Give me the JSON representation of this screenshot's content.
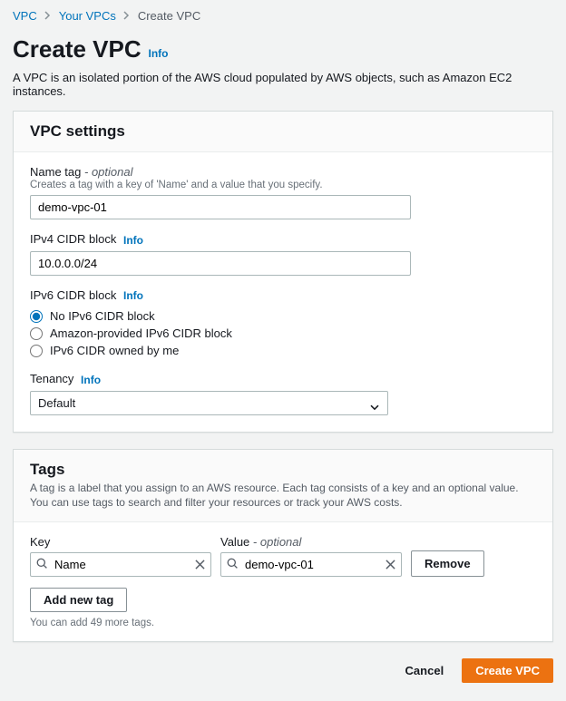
{
  "breadcrumb": {
    "items": [
      "VPC",
      "Your VPCs",
      "Create VPC"
    ]
  },
  "header": {
    "title": "Create VPC",
    "info": "Info",
    "description": "A VPC is an isolated portion of the AWS cloud populated by AWS objects, such as Amazon EC2 instances."
  },
  "settings": {
    "panel_title": "VPC settings",
    "name_tag": {
      "label": "Name tag",
      "optional_suffix": "- optional",
      "hint": "Creates a tag with a key of 'Name' and a value that you specify.",
      "value": "demo-vpc-01"
    },
    "ipv4": {
      "label": "IPv4 CIDR block",
      "info": "Info",
      "value": "10.0.0.0/24"
    },
    "ipv6": {
      "label": "IPv6 CIDR block",
      "info": "Info",
      "options": [
        "No IPv6 CIDR block",
        "Amazon-provided IPv6 CIDR block",
        "IPv6 CIDR owned by me"
      ],
      "selected_index": 0
    },
    "tenancy": {
      "label": "Tenancy",
      "info": "Info",
      "value": "Default"
    }
  },
  "tags": {
    "panel_title": "Tags",
    "description": "A tag is a label that you assign to an AWS resource. Each tag consists of a key and an optional value. You can use tags to search and filter your resources or track your AWS costs.",
    "key_label": "Key",
    "value_label": "Value",
    "value_optional_suffix": "- optional",
    "row": {
      "key": "Name",
      "value": "demo-vpc-01"
    },
    "remove_label": "Remove",
    "add_label": "Add new tag",
    "limit_text": "You can add 49 more tags."
  },
  "footer": {
    "cancel": "Cancel",
    "create": "Create VPC"
  }
}
